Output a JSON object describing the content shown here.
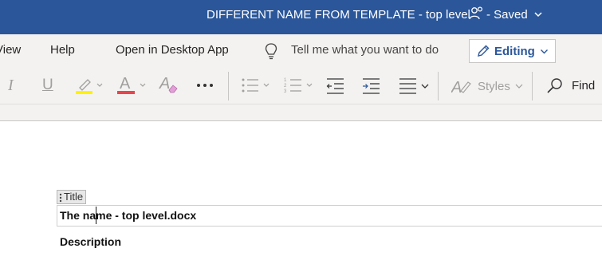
{
  "titlebar": {
    "document_title": "DIFFERENT NAME FROM TEMPLATE - top level",
    "save_status": "- Saved",
    "icons": [
      "coauthor-icon",
      "chevron-down-icon"
    ]
  },
  "menubar": {
    "items": [
      "View",
      "Help",
      "Open in Desktop App"
    ],
    "tell_me": "Tell me what you want to do",
    "mode": "Editing"
  },
  "ribbon": {
    "icons": [
      "italic-icon",
      "underline-icon",
      "highlight-icon",
      "font-color-icon",
      "clear-formatting-icon",
      "more-icon",
      "bullets-icon",
      "numbering-icon",
      "decrease-indent-icon",
      "increase-indent-icon",
      "align-icon",
      "styles-icon",
      "find-icon"
    ],
    "styles_label": "Styles",
    "find_label": "Find",
    "italic_glyph": "I",
    "underline_glyph": "U",
    "font_color_glyph": "A",
    "clear_format_glyph": "A",
    "colors": {
      "highlight": "#fff100",
      "font_color": "#e8464c"
    }
  },
  "document": {
    "content_control_tag": "Title",
    "title_value": "The name - top level.docx",
    "description_label": "Description"
  },
  "colors": {
    "titlebar": "#2b579a",
    "accent": "#2b579a",
    "ribbon": "#f3f2f1"
  }
}
